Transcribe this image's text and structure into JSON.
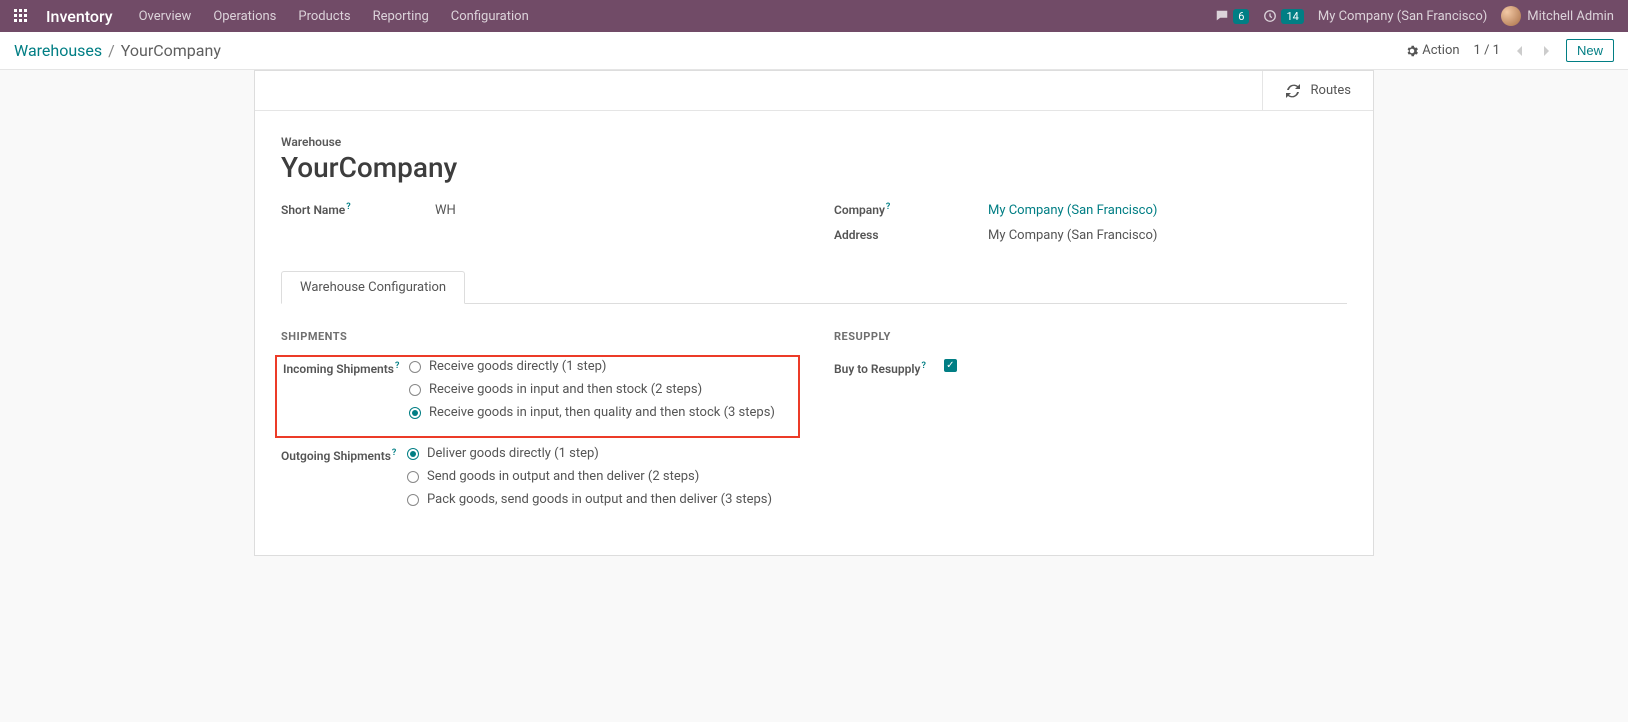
{
  "navbar": {
    "brand": "Inventory",
    "links": [
      "Overview",
      "Operations",
      "Products",
      "Reporting",
      "Configuration"
    ],
    "messages_badge": "6",
    "activities_badge": "14",
    "company": "My Company (San Francisco)",
    "user": "Mitchell Admin"
  },
  "controlbar": {
    "breadcrumb_parent": "Warehouses",
    "breadcrumb_current": "YourCompany",
    "action_label": "Action",
    "pager": "1 / 1",
    "new_label": "New"
  },
  "statbar": {
    "routes_label": "Routes"
  },
  "form": {
    "warehouse_label": "Warehouse",
    "title": "YourCompany",
    "short_name_label": "Short Name",
    "short_name_value": "WH",
    "company_label": "Company",
    "company_value": "My Company (San Francisco)",
    "address_label": "Address",
    "address_value": "My Company (San Francisco)",
    "tab_label": "Warehouse Configuration"
  },
  "shipments": {
    "section": "SHIPMENTS",
    "incoming_label": "Incoming Shipments",
    "incoming_options": [
      "Receive goods directly (1 step)",
      "Receive goods in input and then stock (2 steps)",
      "Receive goods in input, then quality and then stock (3 steps)"
    ],
    "outgoing_label": "Outgoing Shipments",
    "outgoing_options": [
      "Deliver goods directly (1 step)",
      "Send goods in output and then deliver (2 steps)",
      "Pack goods, send goods in output and then deliver (3 steps)"
    ]
  },
  "resupply": {
    "section": "RESUPPLY",
    "buy_label": "Buy to Resupply"
  }
}
